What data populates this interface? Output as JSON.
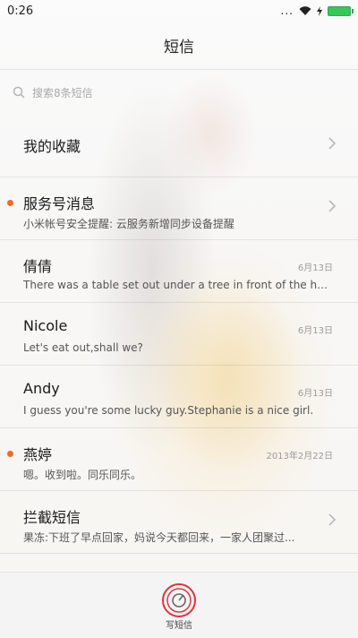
{
  "status": {
    "time": "0:26",
    "signal_text": "..."
  },
  "header": {
    "title": "短信"
  },
  "search": {
    "placeholder": "搜索8条短信"
  },
  "list": [
    {
      "name": "我的收藏",
      "preview": "",
      "date": "",
      "unread": false,
      "chevron": true
    },
    {
      "name": "服务号消息",
      "preview": "小米帐号安全提醒: 云服务新增同步设备提醒",
      "date": "",
      "unread": true,
      "chevron": true
    },
    {
      "name": "倩倩",
      "preview": "There was a table set out under a tree in front of the ho...",
      "date": "6月13日",
      "unread": false,
      "chevron": false
    },
    {
      "name": "Nicole",
      "preview": "Let's eat out,shall we?",
      "date": "6月13日",
      "unread": false,
      "chevron": false
    },
    {
      "name": "Andy",
      "preview": "I guess you're some lucky guy.Stephanie is a nice girl.",
      "date": "6月13日",
      "unread": false,
      "chevron": false
    },
    {
      "name": "燕婷",
      "preview": "嗯。收到啦。同乐同乐。",
      "date": "2013年2月22日",
      "unread": true,
      "chevron": false
    },
    {
      "name": "拦截短信",
      "preview": "果冻:下班了早点回家，妈说今天都回来，一家人团聚过...",
      "date": "",
      "unread": false,
      "chevron": true
    }
  ],
  "compose": {
    "label": "写短信"
  },
  "colors": {
    "unread_dot": "#ef6c2b",
    "compose_ring": "#e0343f",
    "battery": "#34c759"
  }
}
